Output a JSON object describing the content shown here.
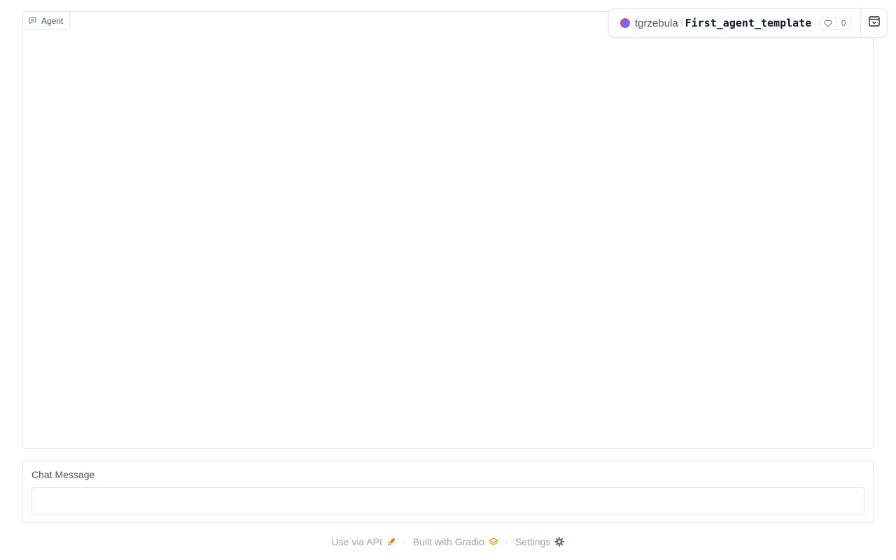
{
  "chatbot": {
    "label": "Agent",
    "label_icon": "chat-bubble-icon"
  },
  "space_header": {
    "owner": "tgrzebula",
    "separator": "/",
    "name": "First_agent_template",
    "likes": "0",
    "like_icon": "heart-icon",
    "collapse_icon": "collapse-icon"
  },
  "chat_input": {
    "label": "Chat Message",
    "value": "",
    "placeholder": ""
  },
  "footer": {
    "api_label": "Use via API",
    "api_icon": "rocket-icon",
    "separator": "·",
    "built_label": "Built with Gradio",
    "built_icon": "gradio-logo-icon",
    "settings_label": "Settings",
    "settings_icon": "gear-icon"
  },
  "colors": {
    "accent_orange": "#f97316",
    "border": "#e5e7eb",
    "muted_text": "#9ca3af"
  }
}
